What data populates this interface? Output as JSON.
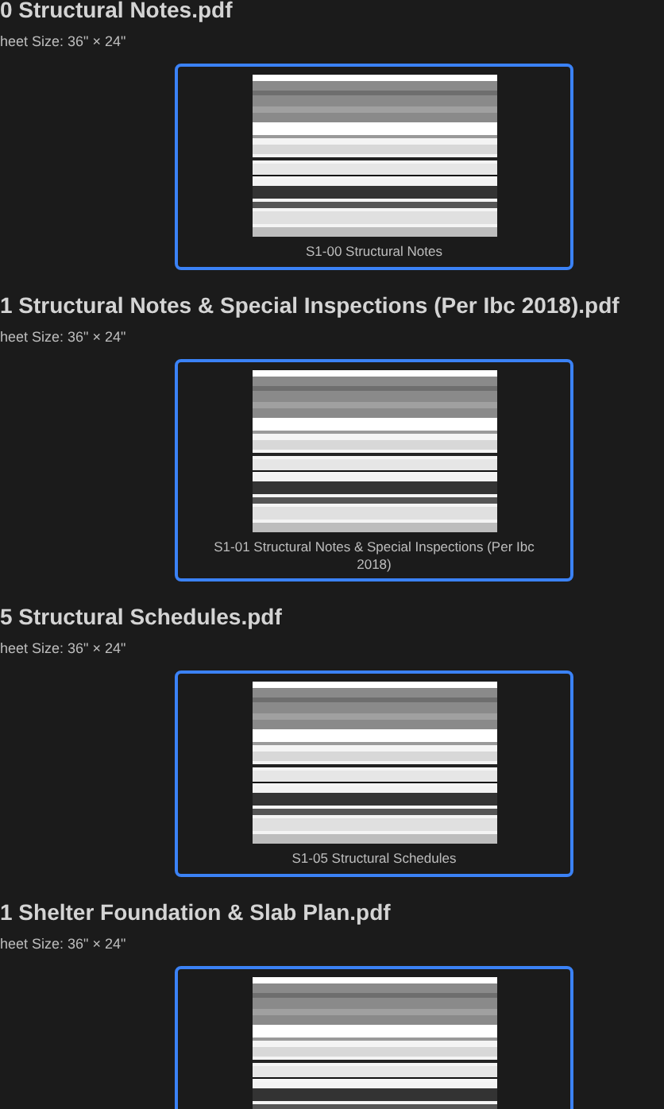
{
  "sheets": [
    {
      "title": "0 Structural Notes.pdf",
      "size": "heet Size: 36\" × 24\"",
      "caption": "S1-00 Structural Notes"
    },
    {
      "title": "1 Structural Notes & Special Inspections (Per Ibc 2018).pdf",
      "size": "heet Size: 36\" × 24\"",
      "caption": "S1-01 Structural Notes & Special Inspections (Per Ibc 2018)"
    },
    {
      "title": "5 Structural Schedules.pdf",
      "size": "heet Size: 36\" × 24\"",
      "caption": "S1-05 Structural Schedules"
    },
    {
      "title": "1 Shelter Foundation & Slab Plan.pdf",
      "size": "heet Size: 36\" × 24\""
    }
  ]
}
